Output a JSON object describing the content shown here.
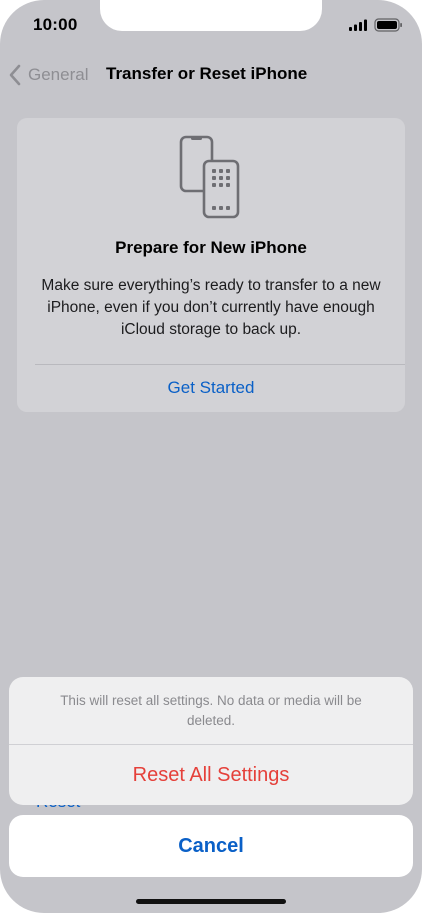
{
  "status_bar": {
    "time": "10:00",
    "icons": [
      "cellular-signal-icon",
      "battery-icon"
    ]
  },
  "nav": {
    "back_label": "General",
    "title": "Transfer or Reset iPhone"
  },
  "prepare_card": {
    "icon": "phone-transfer-icon",
    "title": "Prepare for New iPhone",
    "body": "Make sure everything’s ready to transfer to a new iPhone, even if you don’t currently have enough iCloud storage to back up.",
    "action": "Get Started"
  },
  "background_list": {
    "partial_item": "Reset"
  },
  "action_sheet": {
    "message": "This will reset all settings. No data or media will be deleted.",
    "destructive_action": "Reset All Settings",
    "cancel": "Cancel"
  },
  "colors": {
    "accent_blue": "#0a60c7",
    "destructive_red": "#e5403a",
    "dimmed_background": "#c5c5ca"
  }
}
